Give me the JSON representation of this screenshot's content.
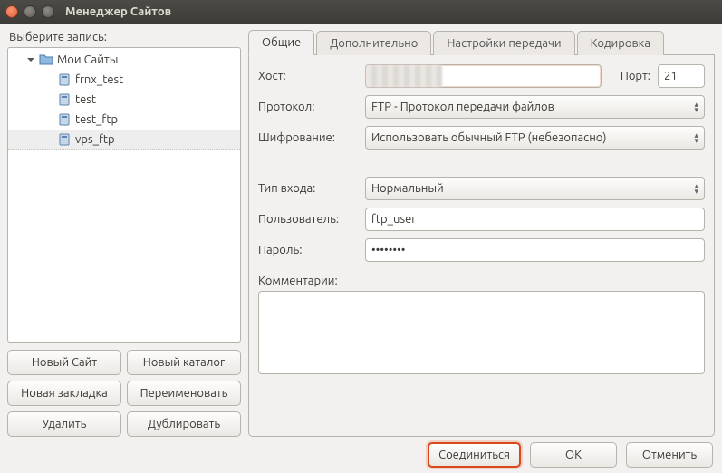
{
  "window": {
    "title": "Менеджер Сайтов"
  },
  "left": {
    "select_label": "Выберите запись:",
    "root": "Мои Сайты",
    "sites": [
      "frnx_test",
      "test",
      "test_ftp",
      "vps_ftp"
    ],
    "selected_index": 3,
    "buttons": {
      "new_site": "Новый Сайт",
      "new_folder": "Новый каталог",
      "new_bookmark": "Новая закладка",
      "rename": "Переименовать",
      "delete": "Удалить",
      "duplicate": "Дублировать"
    }
  },
  "tabs": {
    "items": [
      "Общие",
      "Дополнительно",
      "Настройки передачи",
      "Кодировка"
    ],
    "active_index": 0
  },
  "form": {
    "host_label": "Хост:",
    "host_value": "",
    "port_label": "Порт:",
    "port_value": "21",
    "protocol_label": "Протокол:",
    "protocol_value": "FTP - Протокол передачи файлов",
    "encryption_label": "Шифрование:",
    "encryption_value": "Использовать обычный FTP (небезопасно)",
    "logon_label": "Тип входа:",
    "logon_value": "Нормальный",
    "user_label": "Пользователь:",
    "user_value": "ftp_user",
    "password_label": "Пароль:",
    "password_value": "••••••••",
    "comments_label": "Комментарии:",
    "comments_value": ""
  },
  "bottom": {
    "connect": "Соединиться",
    "ok": "OK",
    "cancel": "Отменить"
  },
  "colors": {
    "accent": "#e25b2c"
  }
}
